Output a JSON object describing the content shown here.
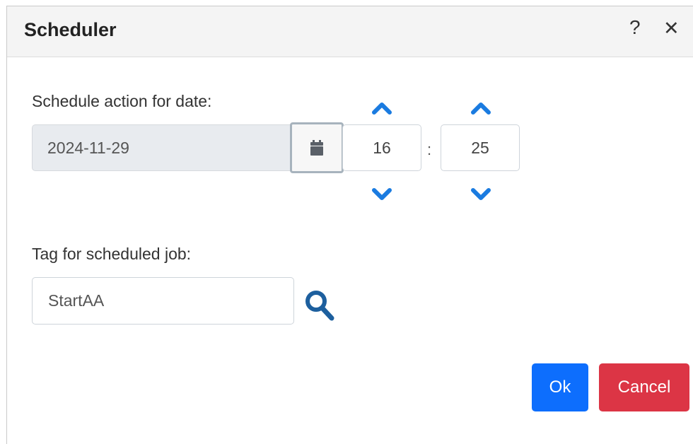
{
  "dialog": {
    "title": "Scheduler",
    "help_label": "?",
    "close_label": "✕"
  },
  "schedule": {
    "date_label": "Schedule action for date:",
    "date_value": "2024-11-29",
    "hour": "16",
    "separator": ":",
    "minute": "25"
  },
  "tag": {
    "label": "Tag for scheduled job:",
    "value": "StartAA"
  },
  "buttons": {
    "ok": "Ok",
    "cancel": "Cancel"
  },
  "colors": {
    "accent": "#0d6efd",
    "danger": "#dc3545",
    "icon_blue": "#1a7be0",
    "search_blue": "#1d5f9e"
  },
  "icons": {
    "calendar": "calendar-icon",
    "chevron_up": "chevron-up-icon",
    "chevron_down": "chevron-down-icon",
    "search": "search-icon"
  }
}
